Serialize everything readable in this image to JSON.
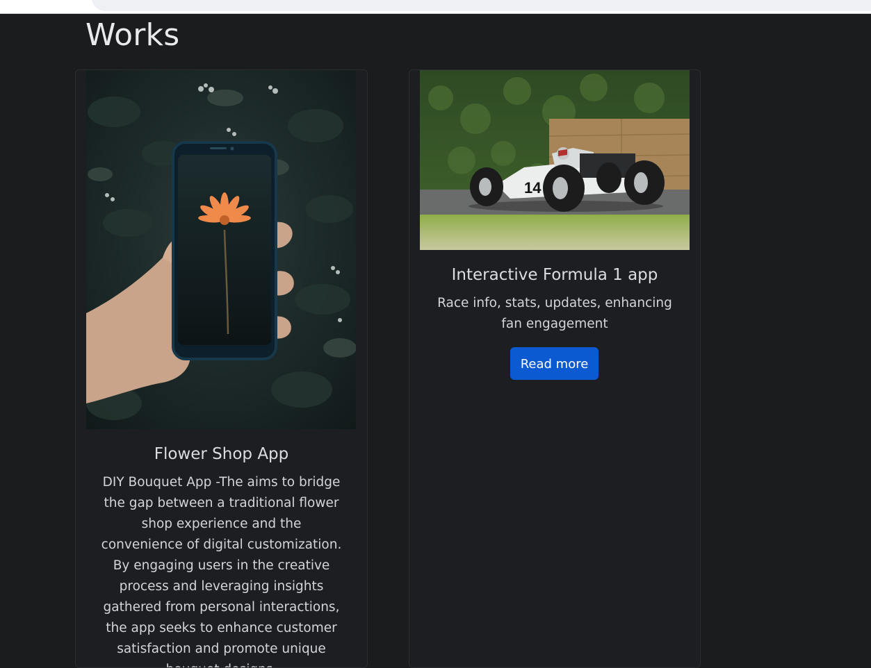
{
  "page": {
    "title": "Works"
  },
  "works": [
    {
      "title": "Flower Shop App",
      "description": "DIY Bouquet App -The aims to bridge the gap between a traditional flower shop experience and the convenience of digital customization. By engaging users in the creative process and leveraging insights gathered from personal interactions, the app seeks to enhance customer satisfaction and promote unique bouquet designs."
    },
    {
      "title": "Interactive Formula 1 app",
      "description": "Race info, stats, updates, enhancing fan engagement",
      "button_label": "Read more"
    }
  ],
  "colors": {
    "background": "#1b1c1e",
    "card": "#1d1e21",
    "button": "#0b5ad1"
  }
}
